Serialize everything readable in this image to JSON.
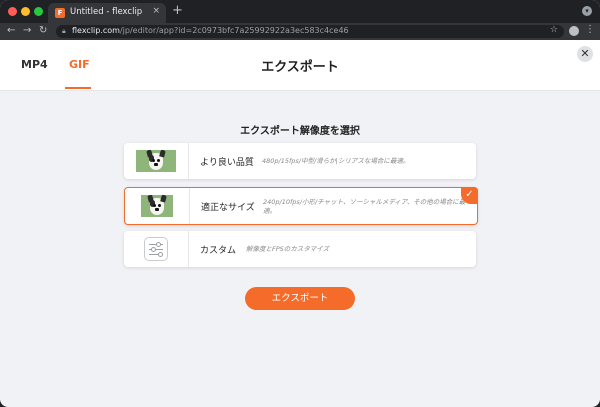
{
  "browser": {
    "tab_title": "Untitled - flexclip",
    "tab_close": "×",
    "new_tab": "+",
    "url_domain": "flexclip.com",
    "url_path": "/jp/editor/app?id=2c0973bfc7a25992922a3ec583c4ce46",
    "icons": [
      "back-icon",
      "forward-icon",
      "reload-icon",
      "lock-icon",
      "star-icon",
      "profile-icon",
      "menu-icon"
    ]
  },
  "header": {
    "tabs": [
      {
        "label": "MP4",
        "active": false
      },
      {
        "label": "GIF",
        "active": true
      }
    ],
    "title": "エクスポート",
    "close_label": "✕"
  },
  "section": {
    "title": "エクスポート解像度を選択"
  },
  "options": [
    {
      "label": "より良い品質",
      "desc": "480p/15fps/中型/滑らか|シリアスな場合に最適。",
      "selected": false
    },
    {
      "label": "適正なサイズ",
      "desc": "240p/10fps/小形/チャット、ソーシャルメディア、その他の場合に最適。",
      "selected": true
    },
    {
      "label": "カスタム",
      "desc": "解像度とFPSのカスタマイズ",
      "selected": false
    }
  ],
  "check_mark": "✓",
  "export_button": "エクスポート",
  "colors": {
    "accent": "#f46b2a",
    "background": "#f1f2f5",
    "chrome_dark": "#202124"
  }
}
